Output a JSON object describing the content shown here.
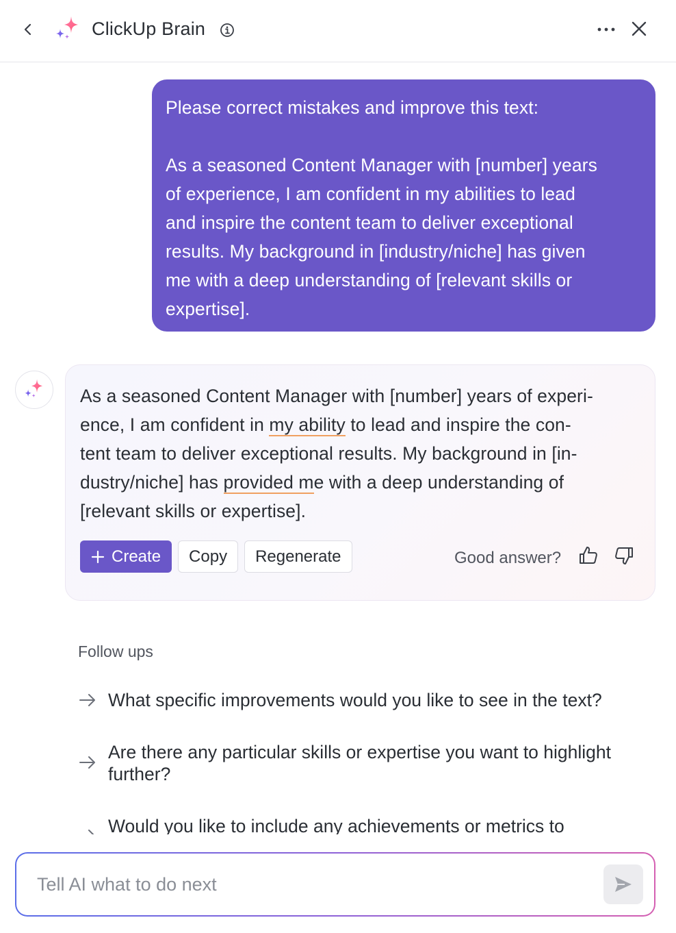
{
  "header": {
    "title": "ClickUp Brain",
    "icons": {
      "back": "chevron-left-icon",
      "brand": "sparkle-icon",
      "info": "info-icon",
      "more": "ellipsis-icon",
      "close": "close-icon"
    }
  },
  "user_message": {
    "lines": [
      "Please correct mistakes and improve this text:",
      "",
      "As a seasoned Content Manager with [number] years",
      "of experience, I am confident in my abilities to lead",
      "and inspire the content team to deliver exceptional",
      "results. My background in [industry/niche] has given",
      "me with a deep understanding of [relevant skills or",
      "expertise]."
    ]
  },
  "ai_response": {
    "line1": "As a seasoned Content Manager with [number] years of experi-",
    "line2_a": "ence, I am confident in ",
    "line2_b": "my ability",
    "line2_c": " to lead and inspire the con-",
    "line3": "tent team to deliver exceptional results. My background in [in-",
    "line4_a": "dustry/niche] has ",
    "line4_b": "provided m",
    "line4_c": "e with a deep understanding of",
    "line5": "[relevant skills or expertise].",
    "buttons": {
      "create": "Create",
      "copy": "Copy",
      "regenerate": "Regenerate"
    },
    "feedback_label": "Good answer?"
  },
  "follow_ups": {
    "title": "Follow ups",
    "items": [
      {
        "lines": [
          "What specific improvements would you like to see in the text?"
        ]
      },
      {
        "lines": [
          "Are there any particular skills or expertise you want to highlight",
          "further?"
        ]
      },
      {
        "lines": [
          "Would you like to include any achievements or metrics to"
        ]
      }
    ]
  },
  "input": {
    "placeholder": "Tell AI what to do next"
  },
  "colors": {
    "accent": "#6a57c8",
    "underline": "#f0a060"
  }
}
